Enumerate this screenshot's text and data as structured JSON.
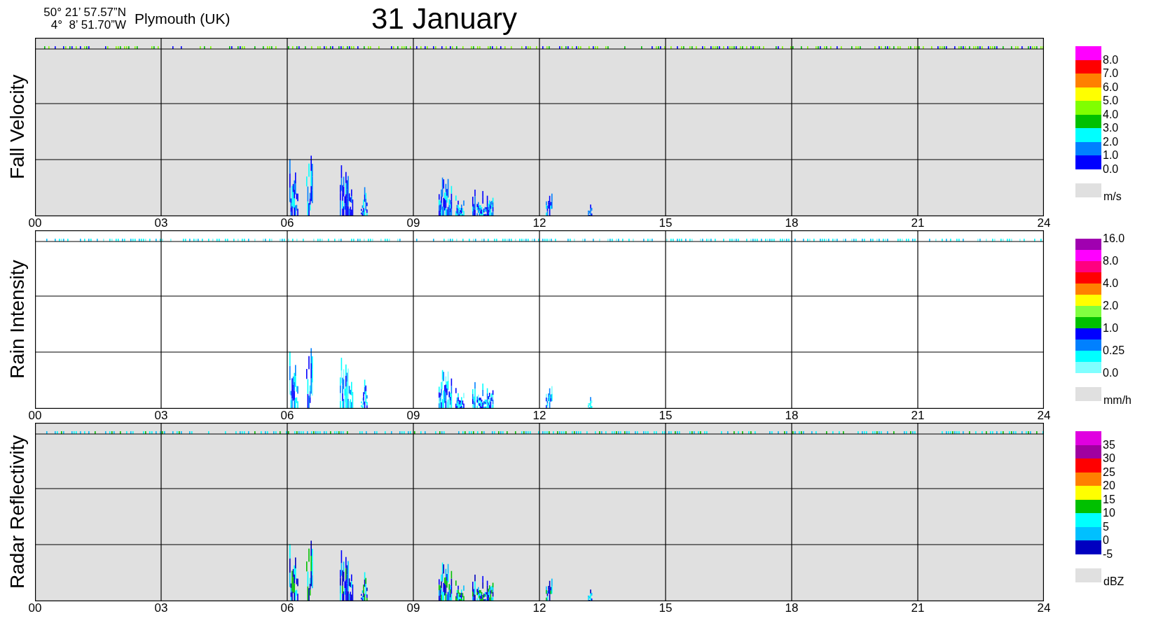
{
  "header": {
    "coordinates": [
      "50° 21’ 57.57”N",
      "4°  8’ 51.70”W"
    ],
    "location": "Plymouth (UK)",
    "title": "31 January"
  },
  "panels": [
    {
      "kind": "velocity",
      "title": "Fall Velocity",
      "shaded": true,
      "x_ticks": [
        "00",
        "03",
        "06",
        "09",
        "12",
        "15",
        "18",
        "21",
        "24"
      ],
      "legend": {
        "swatches": [
          {
            "color": "#ff00ff"
          },
          {
            "color": "#ff0000"
          },
          {
            "color": "#ff8000"
          },
          {
            "color": "#ffff00"
          },
          {
            "color": "#80ff00"
          },
          {
            "color": "#00c000"
          },
          {
            "color": "#00ffff"
          },
          {
            "color": "#0080ff"
          },
          {
            "color": "#0000ff"
          }
        ],
        "labels": [
          "8.0",
          "7.0",
          "6.0",
          "5.0",
          "4.0",
          "3.0",
          "2.0",
          "1.0",
          "0.0"
        ],
        "unit": "m/s"
      }
    },
    {
      "kind": "intensity",
      "title": "Rain Intensity",
      "shaded": false,
      "x_ticks": [
        "00",
        "03",
        "06",
        "09",
        "12",
        "15",
        "18",
        "21",
        "24"
      ],
      "legend": {
        "swatches": [
          {
            "color": "#a000b0"
          },
          {
            "color": "#ff00ff"
          },
          {
            "color": "#ff0080"
          },
          {
            "color": "#ff0000"
          },
          {
            "color": "#ff8000"
          },
          {
            "color": "#ffff00"
          },
          {
            "color": "#80ff40"
          },
          {
            "color": "#00c000"
          },
          {
            "color": "#0000ff"
          },
          {
            "color": "#0080ff"
          },
          {
            "color": "#00ffff"
          },
          {
            "color": "#80ffff"
          }
        ],
        "labels": [
          "16.0",
          "8.0",
          "4.0",
          "2.0",
          "1.0",
          "0.25",
          "0.0"
        ],
        "unit": "mm/h"
      }
    },
    {
      "kind": "reflectivity",
      "title": "Radar Reflectivity",
      "shaded": true,
      "x_ticks": [
        "00",
        "03",
        "06",
        "09",
        "12",
        "15",
        "18",
        "21",
        "24"
      ],
      "legend": {
        "swatches": [
          {
            "color": "#e000e0"
          },
          {
            "color": "#a000a0"
          },
          {
            "color": "#ff0000"
          },
          {
            "color": "#ff8000"
          },
          {
            "color": "#ffff00"
          },
          {
            "color": "#00c000"
          },
          {
            "color": "#00ffff"
          },
          {
            "color": "#00c0ff"
          },
          {
            "color": "#0000c0"
          }
        ],
        "labels": [
          "35",
          "30",
          "25",
          "20",
          "15",
          "10",
          "5",
          "0",
          "-5"
        ],
        "unit": "dBZ"
      }
    }
  ]
}
